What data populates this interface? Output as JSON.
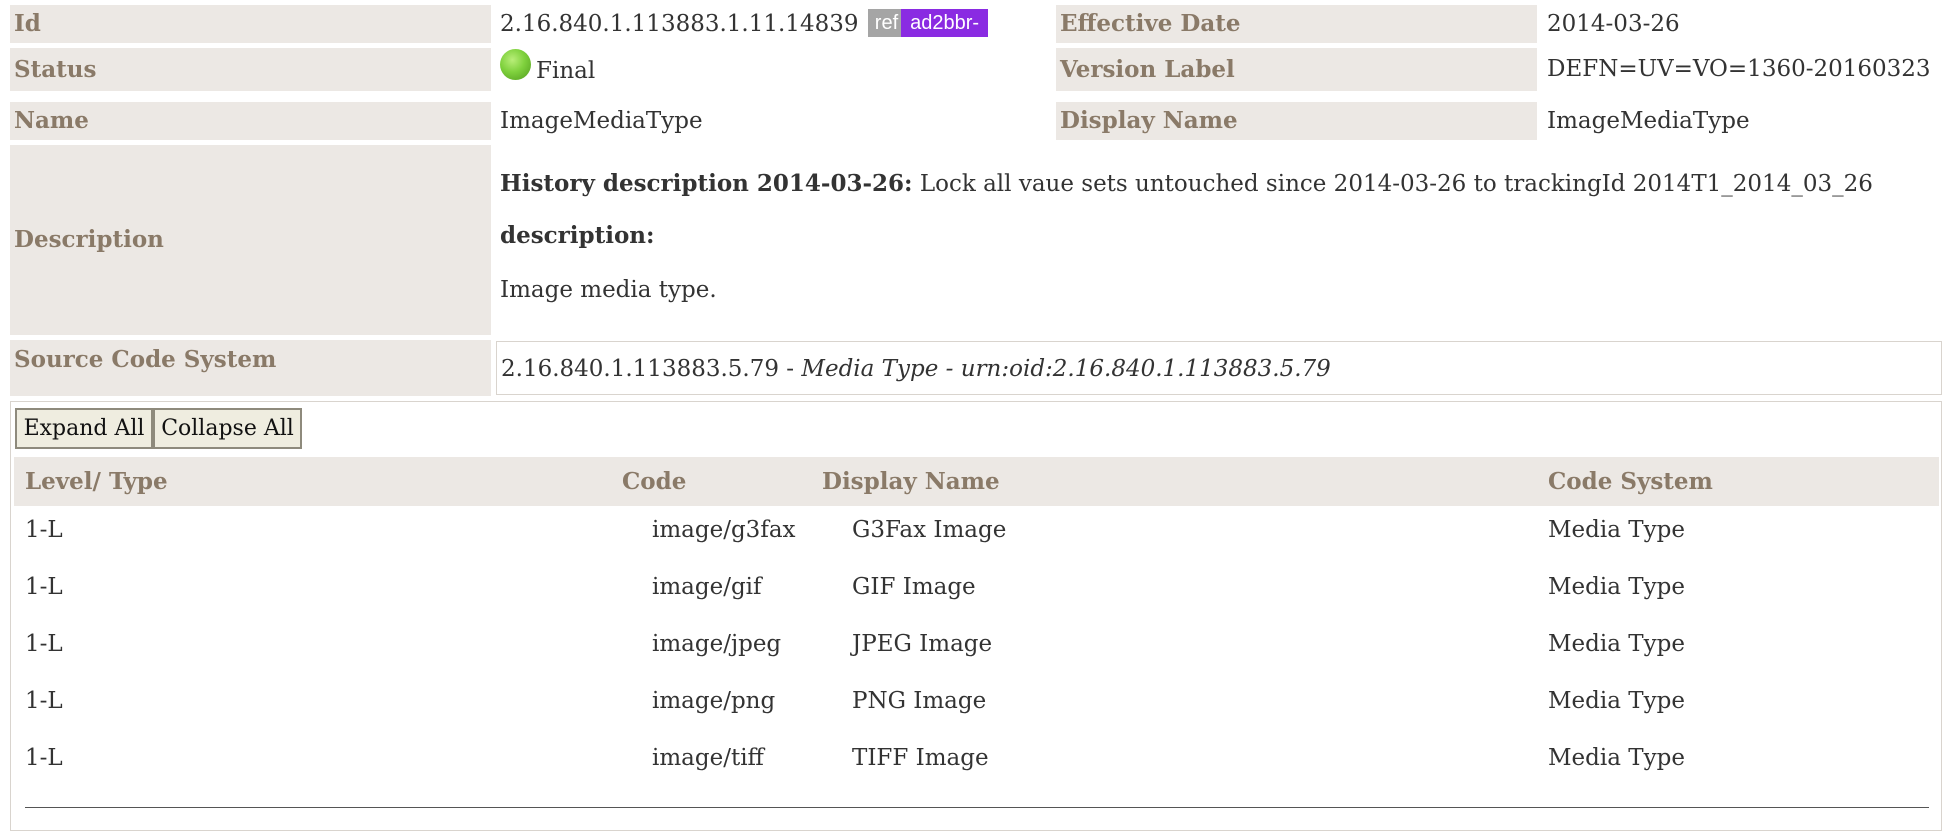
{
  "details": {
    "id_label": "Id",
    "id_value": "2.16.840.1.113883.1.11.14839",
    "ref_badge": "ref",
    "prefix_badge": "ad2bbr-",
    "effective_date_label": "Effective Date",
    "effective_date_value": "2014-03-26",
    "status_label": "Status",
    "status_value": "Final",
    "version_label_label": "Version Label",
    "version_label_value": "DEFN=UV=VO=1360-20160323",
    "name_label": "Name",
    "name_value": "ImageMediaType",
    "display_name_label": "Display Name",
    "display_name_value": "ImageMediaType",
    "description_label": "Description",
    "history_heading": "History description 2014-03-26:",
    "history_text": " Lock all vaue sets untouched since 2014-03-26 to trackingId 2014T1_2014_03_26",
    "description_heading": "description:",
    "description_text": "Image media type.",
    "source_code_system_label": "Source Code System",
    "source_oid": "2.16.840.1.113883.5.79",
    "source_sep1": " - ",
    "source_name": "Media Type",
    "source_sep2": " - ",
    "source_urn": "urn:oid:2.16.840.1.113883.5.79"
  },
  "toolbar": {
    "expand_all": "Expand All",
    "collapse_all": "Collapse All"
  },
  "table": {
    "headers": {
      "level_type": "Level/ Type",
      "code": "Code",
      "display_name": "Display Name",
      "code_system": "Code System"
    },
    "rows": [
      {
        "level": "1-L",
        "code": "image/g3fax",
        "display": "G3Fax Image",
        "system": "Media Type"
      },
      {
        "level": "1-L",
        "code": "image/gif",
        "display": "GIF Image",
        "system": "Media Type"
      },
      {
        "level": "1-L",
        "code": "image/jpeg",
        "display": "JPEG Image",
        "system": "Media Type"
      },
      {
        "level": "1-L",
        "code": "image/png",
        "display": "PNG Image",
        "system": "Media Type"
      },
      {
        "level": "1-L",
        "code": "image/tiff",
        "display": "TIFF Image",
        "system": "Media Type"
      }
    ]
  },
  "colors": {
    "label_bg": "#ece8e4",
    "label_text": "#8a7a68",
    "ref_badge_bg": "#a5a5a5",
    "prefix_badge_bg": "#8a2be2",
    "status_final": "#7fd13d"
  }
}
